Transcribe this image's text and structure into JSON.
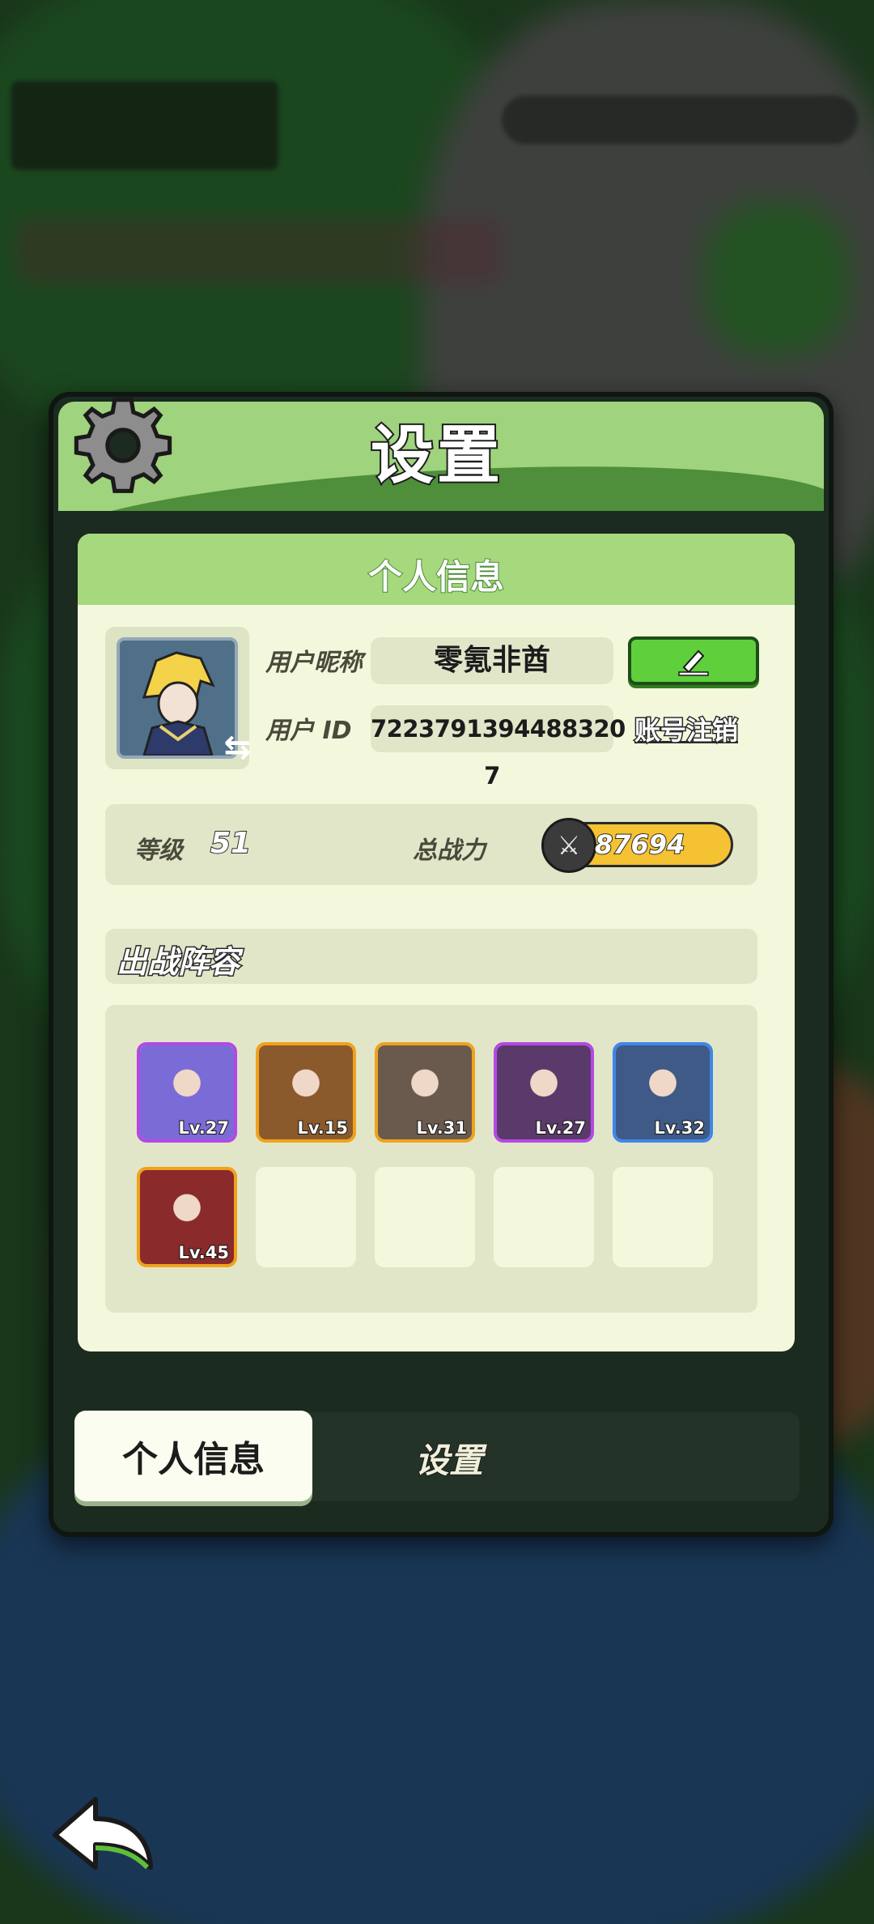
{
  "panel": {
    "title": "设置"
  },
  "profile": {
    "section_title": "个人信息",
    "nickname_label": "用户昵称",
    "nickname": "零氪非酋",
    "id_label": "用户  ID",
    "user_id": "7223791394488320 7",
    "cancel_account": "账号注销",
    "level_label": "等级",
    "level": "51",
    "power_label": "总战力",
    "power": "87694"
  },
  "team": {
    "title": "出战阵容",
    "heroes": [
      {
        "level": "Lv.27",
        "frame": "purple",
        "color": "#7b6bd6"
      },
      {
        "level": "Lv.15",
        "frame": "orange",
        "color": "#8a5a2c"
      },
      {
        "level": "Lv.31",
        "frame": "orange",
        "color": "#6a5a4e"
      },
      {
        "level": "Lv.27",
        "frame": "purple",
        "color": "#5a3a6a"
      },
      {
        "level": "Lv.32",
        "frame": "blue",
        "color": "#3f5a86"
      },
      {
        "level": "Lv.45",
        "frame": "orange",
        "color": "#8a2a2a"
      }
    ]
  },
  "tabs": {
    "personal": "个人信息",
    "settings": "设置"
  },
  "icons": {
    "gear": "gear-icon",
    "edit": "pencil-icon",
    "back": "back-arrow-icon",
    "power": "crossed-swords-icon",
    "switch": "switch-arrows-icon"
  }
}
